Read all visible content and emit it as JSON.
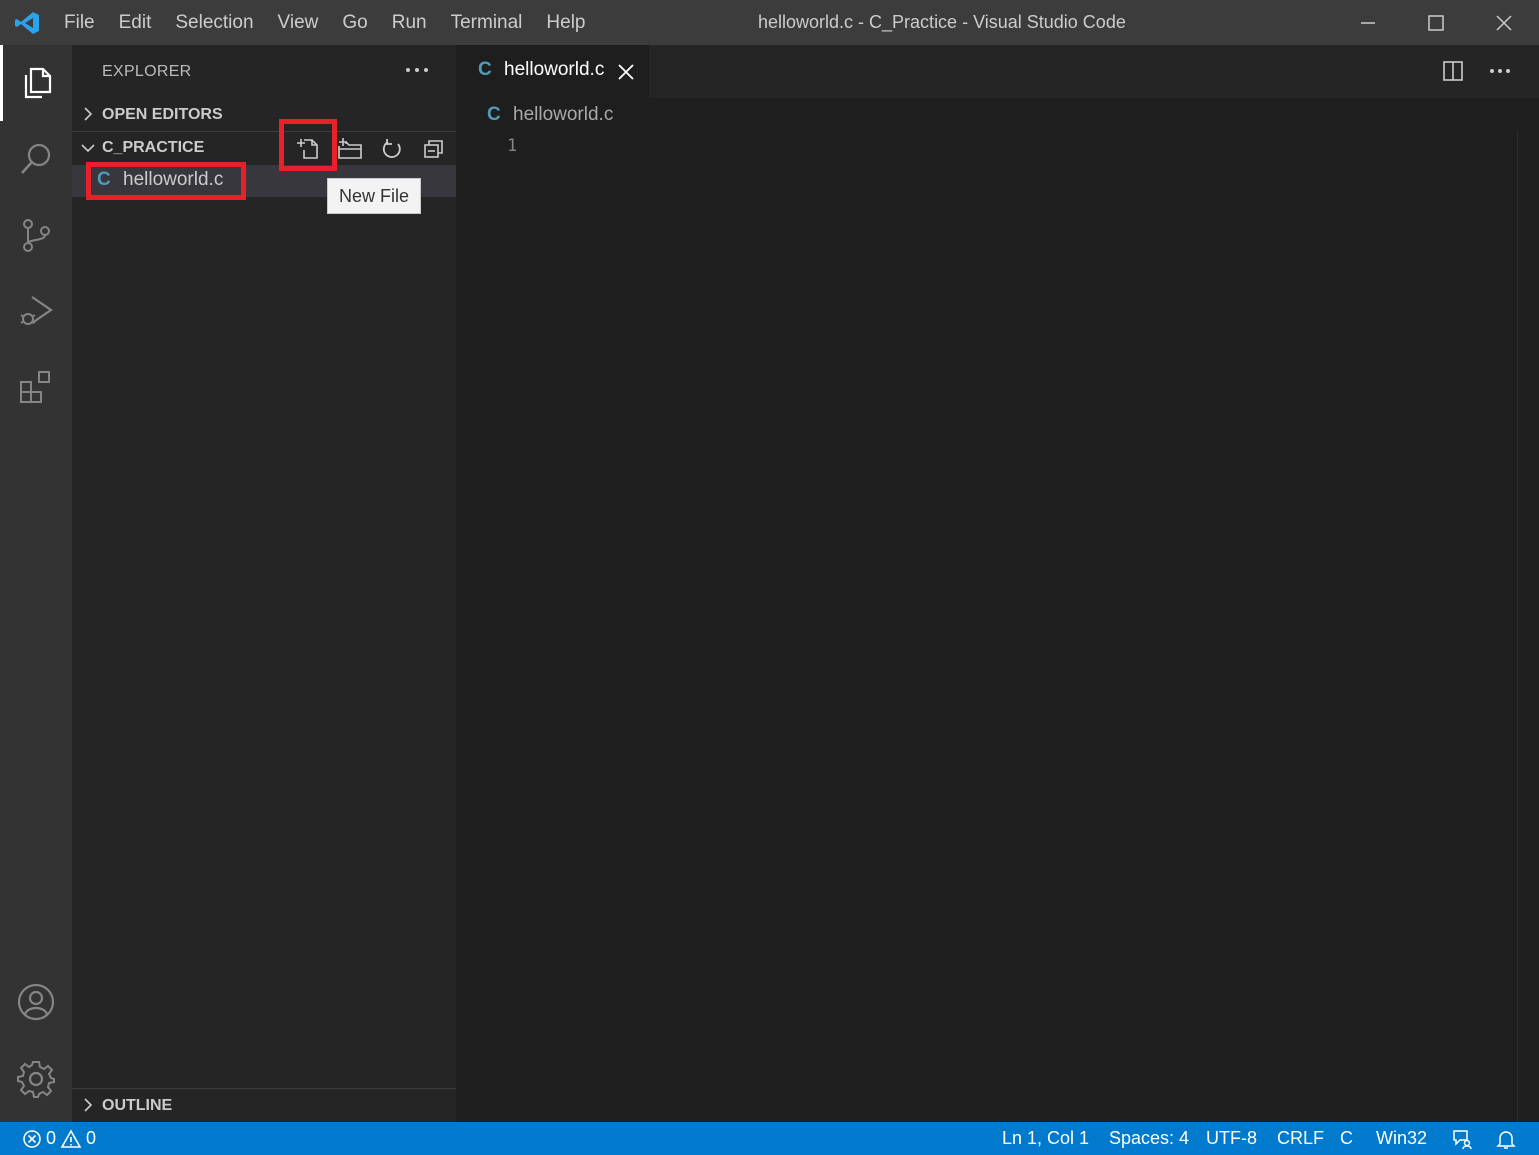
{
  "window": {
    "title": "helloworld.c - C_Practice - Visual Studio Code",
    "menu": [
      "File",
      "Edit",
      "Selection",
      "View",
      "Go",
      "Run",
      "Terminal",
      "Help"
    ]
  },
  "activity_bar": {
    "top": [
      "explorer-icon",
      "search-icon",
      "source-control-icon",
      "run-debug-icon",
      "extensions-icon"
    ],
    "bottom": [
      "account-icon",
      "settings-gear-icon"
    ]
  },
  "sidebar": {
    "title": "EXPLORER",
    "open_editors": "OPEN EDITORS",
    "folder": "C_PRACTICE",
    "folder_actions": [
      "new-file-icon",
      "new-folder-icon",
      "refresh-icon",
      "collapse-all-icon"
    ],
    "files": [
      {
        "icon": "C",
        "name": "helloworld.c"
      }
    ],
    "outline": "OUTLINE",
    "tooltip": "New File"
  },
  "editor": {
    "tab": {
      "icon": "C",
      "label": "helloworld.c"
    },
    "breadcrumb": {
      "icon": "C",
      "label": "helloworld.c"
    },
    "line_numbers": [
      "1"
    ]
  },
  "status_bar": {
    "errors": "0",
    "warnings": "0",
    "position": "Ln 1, Col 1",
    "spaces": "Spaces: 4",
    "encoding": "UTF-8",
    "eol": "CRLF",
    "language": "C",
    "platform": "Win32"
  },
  "colors": {
    "accent": "#007acc",
    "highlight": "#e8202a",
    "c_icon": "#519aba"
  }
}
